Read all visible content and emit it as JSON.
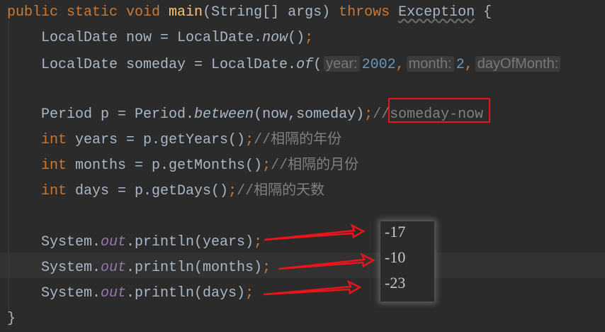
{
  "code_lines": [
    {
      "row": 0,
      "indent": 0,
      "tokens": [
        [
          "public static void ",
          "kw"
        ],
        [
          "main",
          "fn"
        ],
        [
          "(String[] args) ",
          "plain"
        ],
        [
          "throws ",
          "kw"
        ],
        [
          "Exception",
          "warn"
        ],
        [
          " {",
          "plain"
        ]
      ]
    },
    {
      "row": 1,
      "indent": 4,
      "tokens": [
        [
          "LocalDate now = LocalDate.",
          "plain"
        ],
        [
          "now",
          "it"
        ],
        [
          "()",
          "plain"
        ],
        [
          ";",
          "kw"
        ]
      ]
    },
    {
      "row": 2,
      "indent": 4,
      "tokens": [
        [
          "LocalDate someday = LocalDate.",
          "plain"
        ],
        [
          "of",
          "it"
        ],
        [
          "(",
          "plain"
        ],
        [
          "year:",
          "hint"
        ],
        [
          "2002",
          "num"
        ],
        [
          ",",
          "kw"
        ],
        [
          "month:",
          "hint"
        ],
        [
          "2",
          "num"
        ],
        [
          ",",
          "kw"
        ],
        [
          "dayOfMonth:",
          "hint"
        ]
      ]
    },
    {
      "row": 4,
      "indent": 4,
      "tokens": [
        [
          "Period p = Period.",
          "plain"
        ],
        [
          "between",
          "it"
        ],
        [
          "(now,someday)",
          "plain"
        ],
        [
          ";",
          "kw"
        ],
        [
          "//someday-now",
          "cm"
        ]
      ]
    },
    {
      "row": 5,
      "indent": 4,
      "tokens": [
        [
          "int ",
          "kw"
        ],
        [
          "years = p.getYears()",
          "plain"
        ],
        [
          ";",
          "kw"
        ],
        [
          "//相隔的年份",
          "cm"
        ]
      ]
    },
    {
      "row": 6,
      "indent": 4,
      "tokens": [
        [
          "int ",
          "kw"
        ],
        [
          "months = p.getMonths()",
          "plain"
        ],
        [
          ";",
          "kw"
        ],
        [
          "//相隔的月份",
          "cm"
        ]
      ]
    },
    {
      "row": 7,
      "indent": 4,
      "tokens": [
        [
          "int ",
          "kw"
        ],
        [
          "days = p.getDays()",
          "plain"
        ],
        [
          ";",
          "kw"
        ],
        [
          "//相隔的天数",
          "cm"
        ]
      ]
    },
    {
      "row": 9,
      "indent": 4,
      "tokens": [
        [
          "System.",
          "plain"
        ],
        [
          "out",
          "fld"
        ],
        [
          ".println(years)",
          "plain"
        ],
        [
          ";",
          "kw"
        ]
      ]
    },
    {
      "row": 10,
      "indent": 4,
      "tokens": [
        [
          "System.",
          "plain"
        ],
        [
          "out",
          "fld"
        ],
        [
          ".println(months)",
          "plain"
        ],
        [
          ";",
          "kw"
        ]
      ]
    },
    {
      "row": 11,
      "indent": 4,
      "tokens": [
        [
          "System.",
          "plain"
        ],
        [
          "out",
          "fld"
        ],
        [
          ".println(days)",
          "plain"
        ],
        [
          ";",
          "kw"
        ]
      ]
    },
    {
      "row": 12,
      "indent": 0,
      "tokens": [
        [
          "}",
          "plain"
        ]
      ]
    }
  ],
  "output": {
    "values": [
      "-17",
      "-10",
      "-23"
    ]
  },
  "colors": {
    "background": "#2b2b2b",
    "keyword": "#cc7832",
    "annotation_red": "#e8151d"
  }
}
